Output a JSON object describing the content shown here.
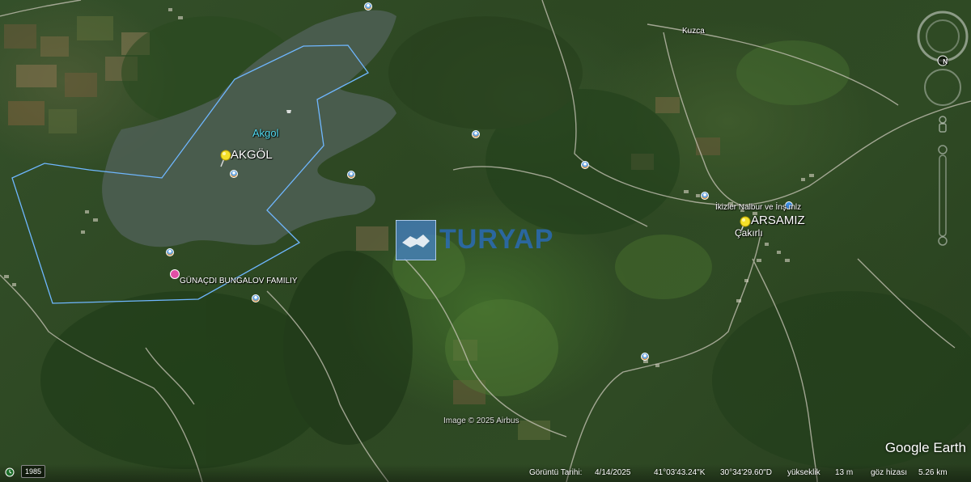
{
  "map": {
    "labels": {
      "lake_name": "Akgol",
      "akgol_pin": "AKGÖL",
      "arsamiz_pin": "ARSAMIZ",
      "cakirli": "Çakırlı",
      "kuzca": "Kuzca",
      "ikizler": "İkizler Nalbur ve İnş.mlz",
      "gunacdi": "GÜNAÇDI BUNGALOV FAMILIY"
    },
    "imagery_credit": "Image © 2025 Airbus",
    "watermark": "TURYAP",
    "pin_color": "#f4e12a",
    "polygon_color": "#6fb7ff"
  },
  "status_bar": {
    "historical_year": "1985",
    "imagery_date_label": "Görüntü Tarihi:",
    "imagery_date": "4/14/2025",
    "latitude": "41°03'43.24\"K",
    "longitude": "30°34'29.60\"D",
    "elevation_label": "yükseklik",
    "elevation": "13 m",
    "eye_alt_label": "göz hizası",
    "eye_alt": "5.26 km"
  },
  "branding": {
    "app_logo": "Google Earth"
  },
  "navigation": {
    "compass_letter": "N"
  }
}
